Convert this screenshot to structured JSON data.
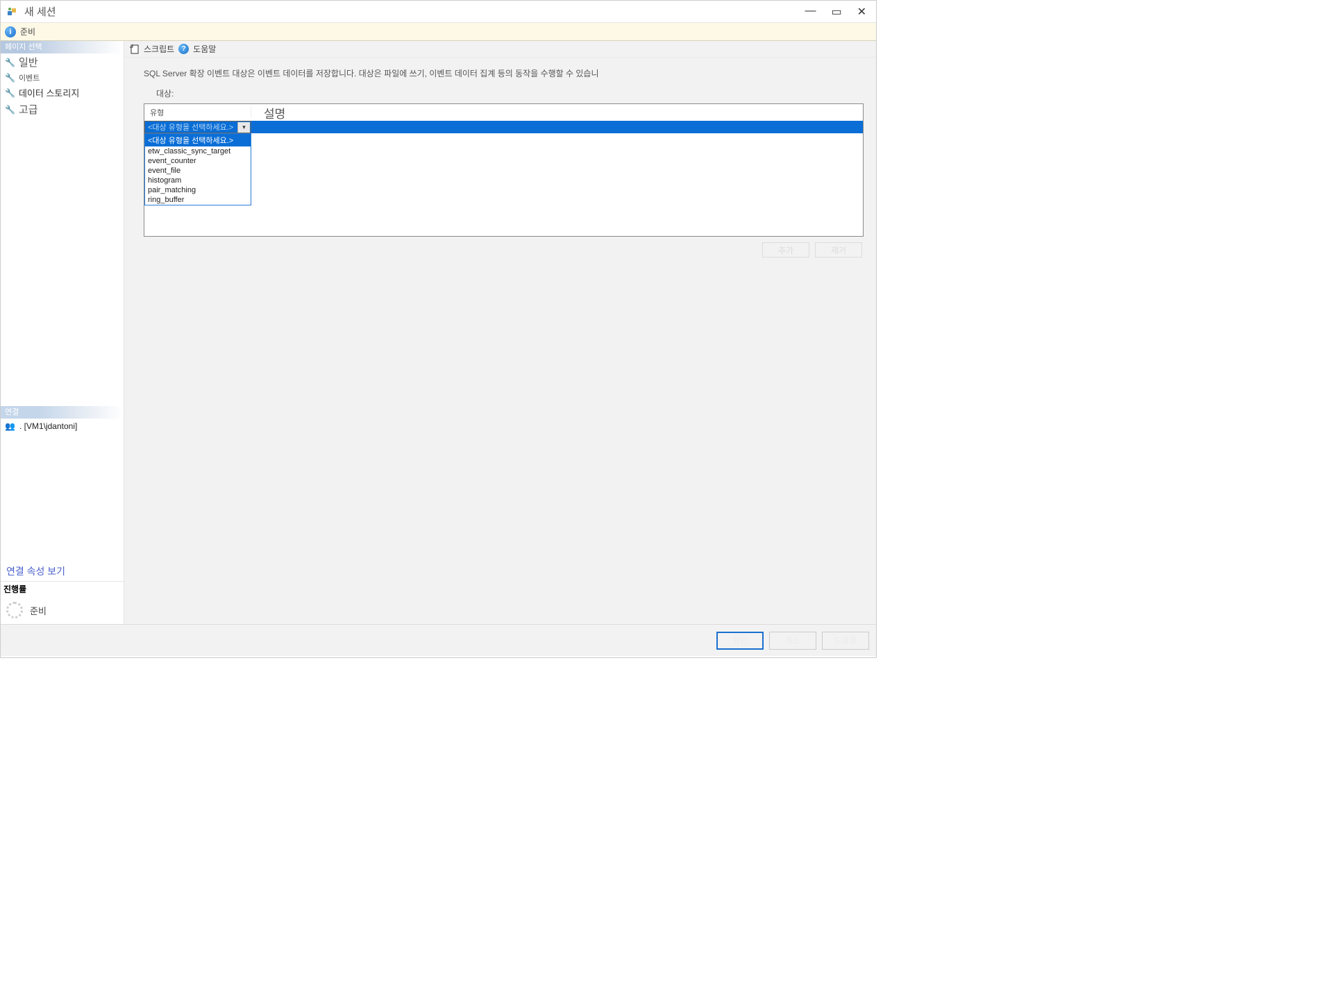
{
  "window": {
    "title": "새 세션"
  },
  "status": {
    "ready": "준비"
  },
  "sidebar": {
    "header": "페이지 선택",
    "items": [
      {
        "label": "일반"
      },
      {
        "label": "이벤트"
      },
      {
        "label": "데이터 스토리지"
      },
      {
        "label": "고급"
      }
    ]
  },
  "toolbar": {
    "script": "스크립트",
    "help": "도움말"
  },
  "content": {
    "description": "SQL Server 확장 이벤트 대상은 이벤트 데이터를 저장합니다. 대상은 파일에 쓰기, 이벤트 데이터 집계 등의 동작을 수행할 수 있습니",
    "targets_label": "대상:",
    "columns": {
      "type": "유형",
      "desc": "설명"
    },
    "selected_placeholder": "<대상 유형을 선택하세요.>",
    "dropdown_options": [
      "<대상 유형을 선택하세요.>",
      "etw_classic_sync_target",
      "event_counter",
      "event_file",
      "histogram",
      "pair_matching",
      "ring_buffer"
    ],
    "add_button": "추가",
    "remove_button": "제거"
  },
  "connection": {
    "header": "연결",
    "info": ". [VM1\\jdantoni]",
    "view_props": "연결 속성 보기"
  },
  "progress": {
    "header": "진행률",
    "status": "준비"
  },
  "footer": {
    "ok": "확인",
    "cancel": "취소",
    "help": "도움말"
  }
}
